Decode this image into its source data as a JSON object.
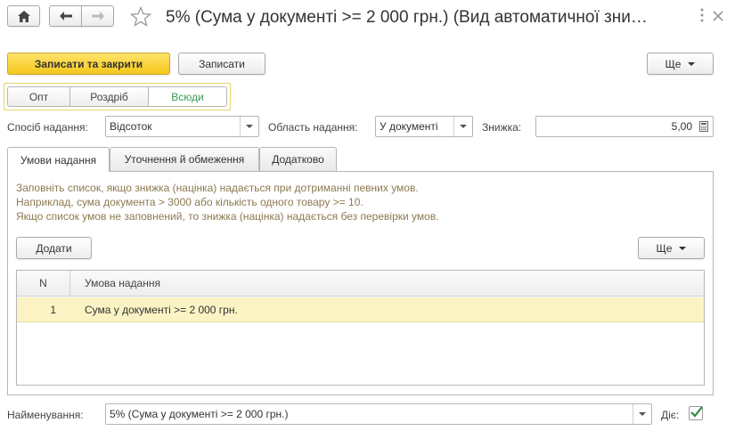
{
  "header": {
    "title": "5% (Сума у документі >= 2 000 грн.) (Вид автоматичної зни…"
  },
  "toolbar": {
    "save_close_label": "Записати та закрити",
    "save_label": "Записати",
    "more_label": "Ще"
  },
  "scope": {
    "options": [
      "Опт",
      "Роздріб",
      "Всюди"
    ],
    "selected": "Всюди"
  },
  "fields": {
    "method_label": "Спосіб надання:",
    "method_value": "Відсоток",
    "area_label": "Область надання:",
    "area_value": "У документі",
    "discount_label": "Знижка:",
    "discount_value": "5,00"
  },
  "tabs": [
    {
      "label": "Умови надання"
    },
    {
      "label": "Уточнення й обмеження"
    },
    {
      "label": "Додатково"
    }
  ],
  "conditions": {
    "hint_lines": [
      "Заповніть список, якщо знижка (націнка) надається при дотриманні певних умов.",
      "Наприклад, сума документа > 3000 або кількість одного товару >= 10.",
      "Якщо список умов не заповнений, то знижка (націнка) надається без перевірки умов."
    ],
    "add_label": "Додати",
    "more_label": "Ще",
    "columns": [
      "N",
      "Умова надання"
    ],
    "rows": [
      {
        "n": "1",
        "condition": "Сума у документі >= 2 000 грн."
      }
    ]
  },
  "footer": {
    "name_label": "Найменування:",
    "name_value": "5% (Сума у документі >= 2 000 грн.)",
    "active_label": "Діє:"
  },
  "colors": {
    "primary_button": "#f5c71a",
    "selected_row": "#fbf3c4",
    "hint_text": "#8c7a4f",
    "selected_scope_text": "#3a9a52",
    "check": "#2e8b3e"
  }
}
